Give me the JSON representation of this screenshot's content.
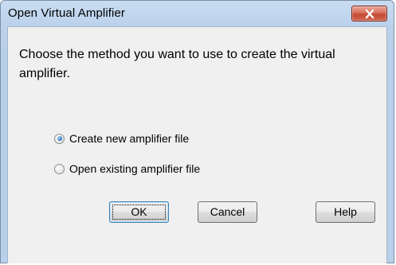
{
  "window": {
    "title": "Open Virtual Amplifier",
    "close_icon": "close-x-icon"
  },
  "dialog": {
    "prompt": "Choose the method you want to use to create the virtual amplifier.",
    "options": [
      {
        "label": "Create new amplifier file",
        "selected": true
      },
      {
        "label": "Open existing amplifier file",
        "selected": false
      }
    ]
  },
  "buttons": {
    "ok": "OK",
    "cancel": "Cancel",
    "help": "Help"
  },
  "colors": {
    "titlebar": "#bcd2ec",
    "client": "#f0f0f0",
    "close_button": "#c44a34",
    "radio_selected": "#3a7fc2"
  }
}
